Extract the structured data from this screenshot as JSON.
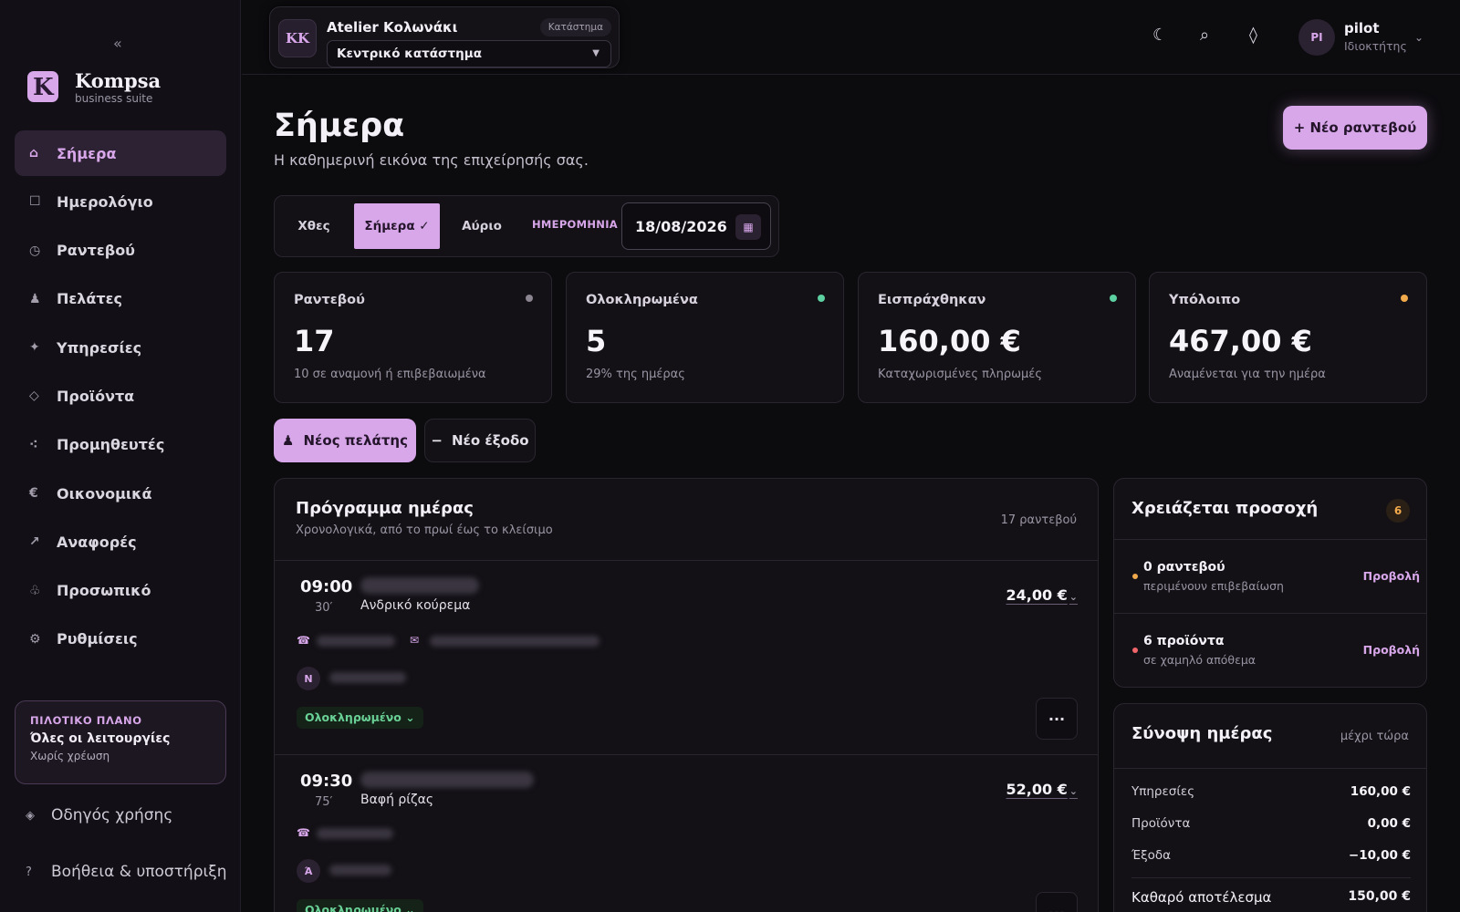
{
  "sidebar": {
    "collapse_icon": "«",
    "brand": {
      "name": "Kompsa",
      "tagline": "business suite",
      "logo_letter": "K"
    },
    "items": [
      {
        "label": "Σήμερα",
        "icon": "home-icon",
        "glyph": "⌂",
        "active": true
      },
      {
        "label": "Ημερολόγιο",
        "icon": "calendar-icon",
        "glyph": "☐",
        "active": false
      },
      {
        "label": "Ραντεβού",
        "icon": "clock-icon",
        "glyph": "◷",
        "active": false
      },
      {
        "label": "Πελάτες",
        "icon": "user-icon",
        "glyph": "♟",
        "active": false
      },
      {
        "label": "Υπηρεσίες",
        "icon": "sparkle-icon",
        "glyph": "✦",
        "active": false
      },
      {
        "label": "Προϊόντα",
        "icon": "diamond-icon",
        "glyph": "◇",
        "active": false
      },
      {
        "label": "Προμηθευτές",
        "icon": "network-icon",
        "glyph": "⁖",
        "active": false
      },
      {
        "label": "Οικονομικά",
        "icon": "euro-icon",
        "glyph": "€",
        "active": false
      },
      {
        "label": "Αναφορές",
        "icon": "arrow-up-right-icon",
        "glyph": "↗",
        "active": false
      },
      {
        "label": "Προσωπικό",
        "icon": "staff-icon",
        "glyph": "♧",
        "active": false
      },
      {
        "label": "Ρυθμίσεις",
        "icon": "gear-icon",
        "glyph": "⚙",
        "active": false
      }
    ],
    "plan": {
      "kicker": "ΠΙΛΟΤΙΚΟ ΠΛΑΝΟ",
      "title": "Όλες οι λειτουργίες",
      "subtitle": "Χωρίς χρέωση"
    },
    "guide_label": "Οδηγός χρήσης",
    "help_label": "Βοήθεια & υποστήριξη"
  },
  "topbar": {
    "business": {
      "initials": "KK",
      "name": "Atelier Κολωνάκι",
      "tag": "Κατάστημα",
      "location": "Κεντρικό κατάστημα"
    },
    "icons": {
      "theme": "☾",
      "search": "⌕",
      "extra": "◊"
    },
    "user": {
      "initials": "PI",
      "name": "pilot",
      "role": "Ιδιοκτήτης"
    }
  },
  "main": {
    "title": "Σήμερα",
    "subtitle": "Η καθημερινή εικόνα της επιχείρησής σας.",
    "new_appointment_label": "+ Νέο ραντεβού",
    "day_tabs": [
      "Χθες",
      "Σήμερα ✓",
      "Αύριο"
    ],
    "date_label": "ΗΜΕΡΟΜΗΝΙΑ",
    "date_value": "18/08/2026",
    "stats": [
      {
        "label": "Ραντεβού",
        "value": "17",
        "note": "10 σε αναμονή ή επιβεβαιωμένα",
        "dot": "#8a8590"
      },
      {
        "label": "Ολοκληρωμένα",
        "value": "5",
        "note": "29% της ημέρας",
        "dot": "#5cd0a0"
      },
      {
        "label": "Εισπράχθηκαν",
        "value": "160,00 €",
        "note": "Καταχωρισμένες πληρωμές",
        "dot": "#5cd0a0"
      },
      {
        "label": "Υπόλοιπο",
        "value": "467,00 €",
        "note": "Αναμένεται για την ημέρα",
        "dot": "#f0a94b"
      }
    ],
    "quick_actions": {
      "new_client": "Νέος πελάτης",
      "new_expense": "Νέο έξοδο"
    },
    "schedule": {
      "title": "Πρόγραμμα ημέρας",
      "subtitle": "Χρονολογικά, από το πρωί έως το κλείσιμο",
      "count": "17 ραντεβού",
      "appointments": [
        {
          "time": "09:00",
          "duration": "30′",
          "service": "Ανδρικό κούρεμα",
          "price": "24,00 €",
          "staff_initial": "N",
          "status": "Ολοκληρωμένο ⌄"
        },
        {
          "time": "09:30",
          "duration": "75′",
          "service": "Βαφή ρίζας",
          "price": "52,00 €",
          "staff_initial": "Ά",
          "status": "Ολοκληρωμένο ⌄"
        }
      ],
      "more_label": "···"
    }
  },
  "attention": {
    "title": "Χρειάζεται προσοχή",
    "count": "6",
    "items": [
      {
        "title": "0 ραντεβού",
        "subtitle": "περιμένουν επιβεβαίωση",
        "link": "Προβολή",
        "dot": "#f0a94b"
      },
      {
        "title": "6 προϊόντα",
        "subtitle": "σε χαμηλό απόθεμα",
        "link": "Προβολή",
        "dot": "#f0656a"
      }
    ]
  },
  "summary": {
    "title": "Σύνοψη ημέρας",
    "period": "μέχρι τώρα",
    "rows": [
      {
        "label": "Υπηρεσίες",
        "value": "160,00 €"
      },
      {
        "label": "Προϊόντα",
        "value": "0,00 €"
      },
      {
        "label": "Έξοδα",
        "value": "−10,00 €"
      }
    ],
    "net": {
      "label": "Καθαρό αποτέλεσμα",
      "value": "150,00 €"
    }
  }
}
